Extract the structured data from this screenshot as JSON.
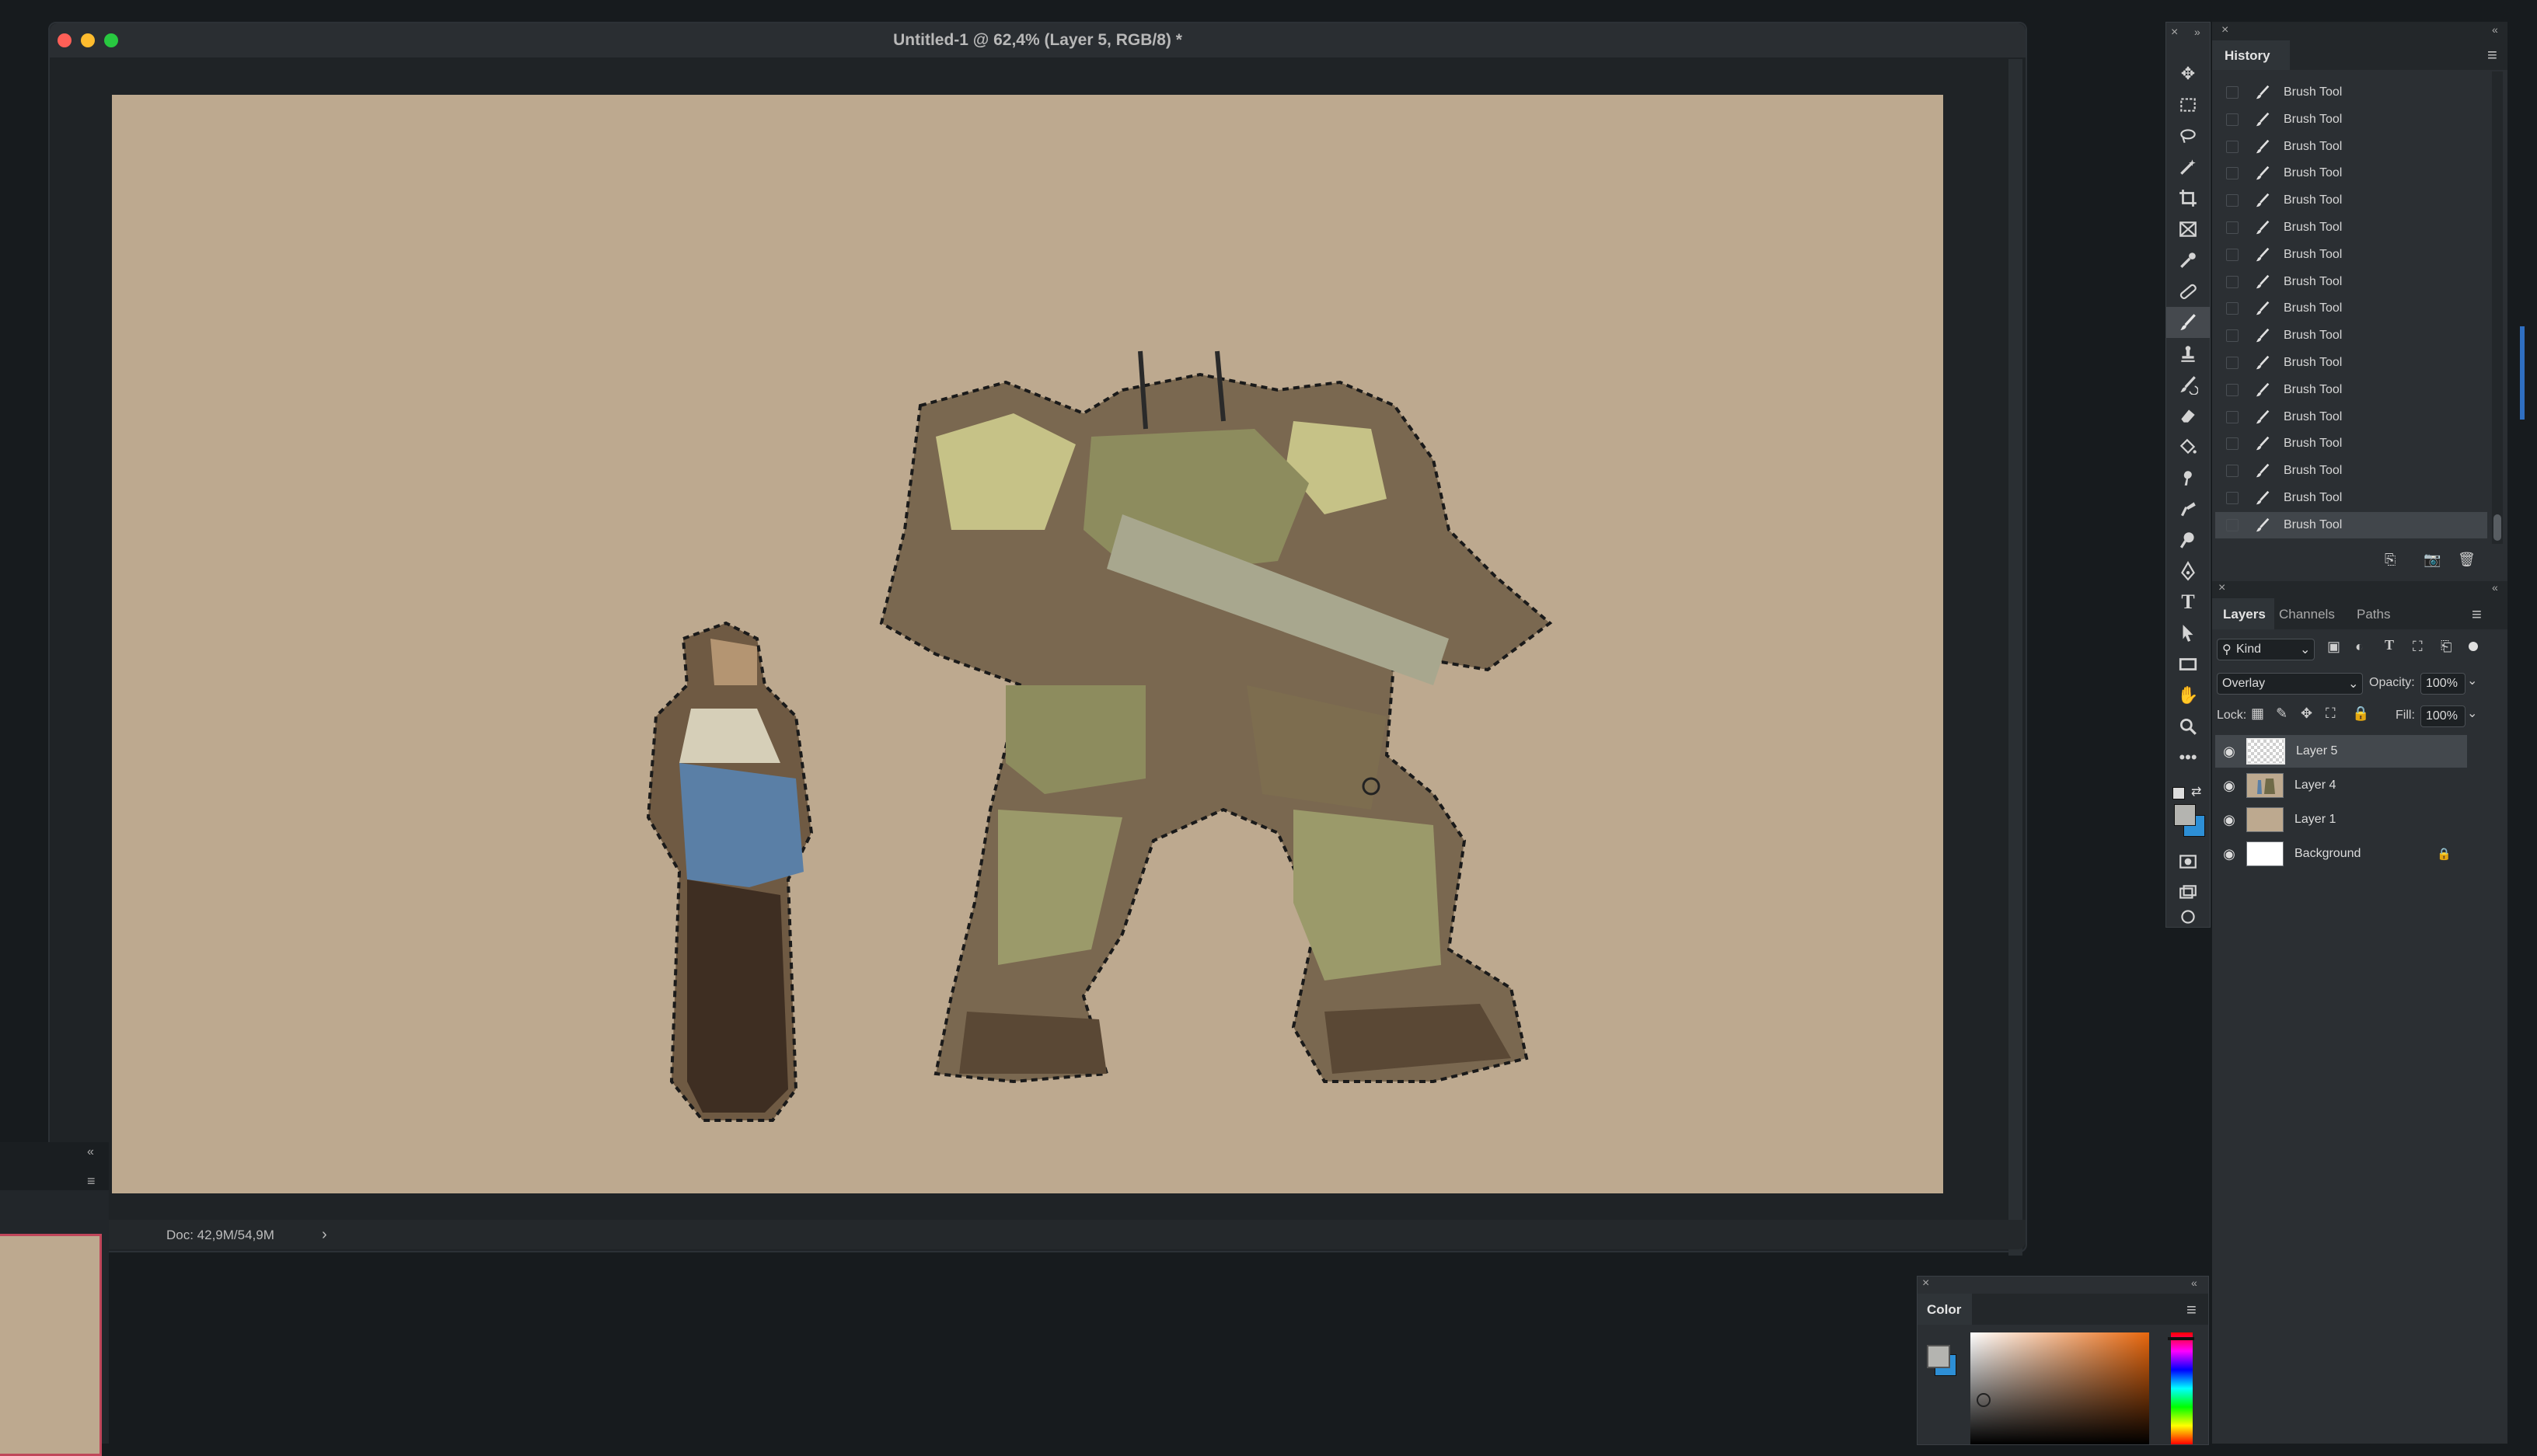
{
  "document": {
    "title": "Untitled-1 @ 62,4% (Layer 5, RGB/8) *",
    "status": "Doc: 42,9M/54,9M",
    "status_arrow": "›"
  },
  "colors": {
    "canvas": "#bda98f",
    "close": "#fe5f57",
    "minimize": "#febc2e",
    "zoom": "#28c840",
    "selected_row": "#43484d"
  },
  "tools": [
    "move-icon",
    "marquee-icon",
    "lasso-icon",
    "magic-wand-icon",
    "crop-icon",
    "frame-icon",
    "eyedropper-icon",
    "healing-icon",
    "brush-icon",
    "stamp-icon",
    "history-brush-icon",
    "eraser-icon",
    "paint-bucket-icon",
    "smudge-icon",
    "dodge-icon",
    "burn-icon",
    "pen-icon",
    "type-icon",
    "path-select-icon",
    "rectangle-icon",
    "hand-icon",
    "zoom-icon",
    "more-icon"
  ],
  "history": {
    "tab": "History",
    "items": [
      "Brush Tool",
      "Brush Tool",
      "Brush Tool",
      "Brush Tool",
      "Brush Tool",
      "Brush Tool",
      "Brush Tool",
      "Brush Tool",
      "Brush Tool",
      "Brush Tool",
      "Brush Tool",
      "Brush Tool",
      "Brush Tool",
      "Brush Tool",
      "Brush Tool",
      "Brush Tool",
      "Brush Tool"
    ],
    "selected_index": 16
  },
  "layers_panel": {
    "tabs": [
      "Layers",
      "Channels",
      "Paths"
    ],
    "filter_label": "Kind",
    "blend_mode": "Overlay",
    "opacity_label": "Opacity:",
    "opacity_value": "100%",
    "lock_label": "Lock:",
    "fill_label": "Fill:",
    "fill_value": "100%",
    "layers": [
      "Layer 5",
      "Layer 4",
      "Layer 1",
      "Background"
    ],
    "selected_index": 0
  },
  "color_panel": {
    "tab": "Color"
  }
}
